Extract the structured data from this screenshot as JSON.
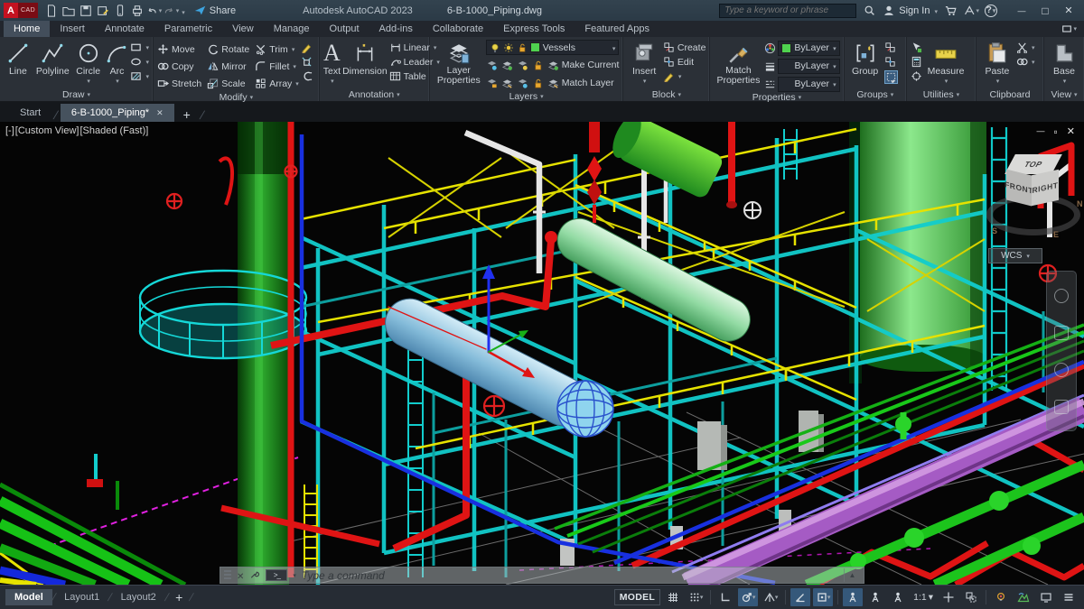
{
  "title_bar": {
    "logo_a": "A",
    "logo_cad": "CAD",
    "product": "Autodesk AutoCAD 2023",
    "document": "6-B-1000_Piping.dwg",
    "share": "Share",
    "search_placeholder": "Type a keyword or phrase",
    "sign_in": "Sign In"
  },
  "ribbon_tabs": [
    {
      "label": "Home",
      "active": true
    },
    {
      "label": "Insert"
    },
    {
      "label": "Annotate"
    },
    {
      "label": "Parametric"
    },
    {
      "label": "View"
    },
    {
      "label": "Manage"
    },
    {
      "label": "Output"
    },
    {
      "label": "Add-ins"
    },
    {
      "label": "Collaborate"
    },
    {
      "label": "Express Tools"
    },
    {
      "label": "Featured Apps"
    }
  ],
  "panels": {
    "draw": {
      "caption": "Draw",
      "line": "Line",
      "polyline": "Polyline",
      "circle": "Circle",
      "arc": "Arc"
    },
    "modify": {
      "caption": "Modify",
      "move": "Move",
      "copy": "Copy",
      "stretch": "Stretch",
      "rotate": "Rotate",
      "mirror": "Mirror",
      "scale": "Scale",
      "trim": "Trim",
      "fillet": "Fillet",
      "array": "Array"
    },
    "annotation": {
      "caption": "Annotation",
      "text": "Text",
      "text_glyph": "A",
      "dimension": "Dimension",
      "linear": "Linear",
      "leader": "Leader",
      "table": "Table"
    },
    "layers": {
      "caption": "Layers",
      "layer_properties": "Layer Properties",
      "current_layer": "Vessels",
      "make_current": "Make Current",
      "match_layer": "Match Layer"
    },
    "block": {
      "caption": "Block",
      "insert": "Insert",
      "create": "Create",
      "edit": "Edit"
    },
    "properties": {
      "caption": "Properties",
      "match_properties": "Match Properties",
      "color": "ByLayer",
      "lineweight": "ByLayer",
      "linetype": "ByLayer"
    },
    "groups": {
      "caption": "Groups",
      "group": "Group"
    },
    "utilities": {
      "caption": "Utilities",
      "measure": "Measure"
    },
    "clipboard": {
      "caption": "Clipboard",
      "paste": "Paste"
    },
    "view": {
      "caption": "View",
      "base": "Base"
    }
  },
  "file_tabs": {
    "start": "Start",
    "drawing": "6-B-1000_Piping*"
  },
  "viewport": {
    "controls_minus": "[-]",
    "controls_view": "[Custom View]",
    "controls_shade": "[Shaded (Fast)]",
    "command_placeholder": "Type a command",
    "viewcube": {
      "top": "TOP",
      "front": "FRONT",
      "right": "RIGHT",
      "wcs": "WCS",
      "north": "N",
      "east": "E",
      "south": "S"
    }
  },
  "status_bar": {
    "model_tab": "Model",
    "layout1": "Layout1",
    "layout2": "Layout2",
    "model_badge": "MODEL",
    "scale": "1:1"
  },
  "colors": {
    "toggle_active": "#35587a",
    "layer_swatch": "#4fd24f",
    "steel_cyan": "#12d0d0",
    "rail_yellow": "#e6e200",
    "pipe_red": "#df1414",
    "pipe_purple": "#a55bc4",
    "vessel_blue": "#85bcda",
    "vessel_green": "#93dba4",
    "column_green": "#2fae2f"
  }
}
